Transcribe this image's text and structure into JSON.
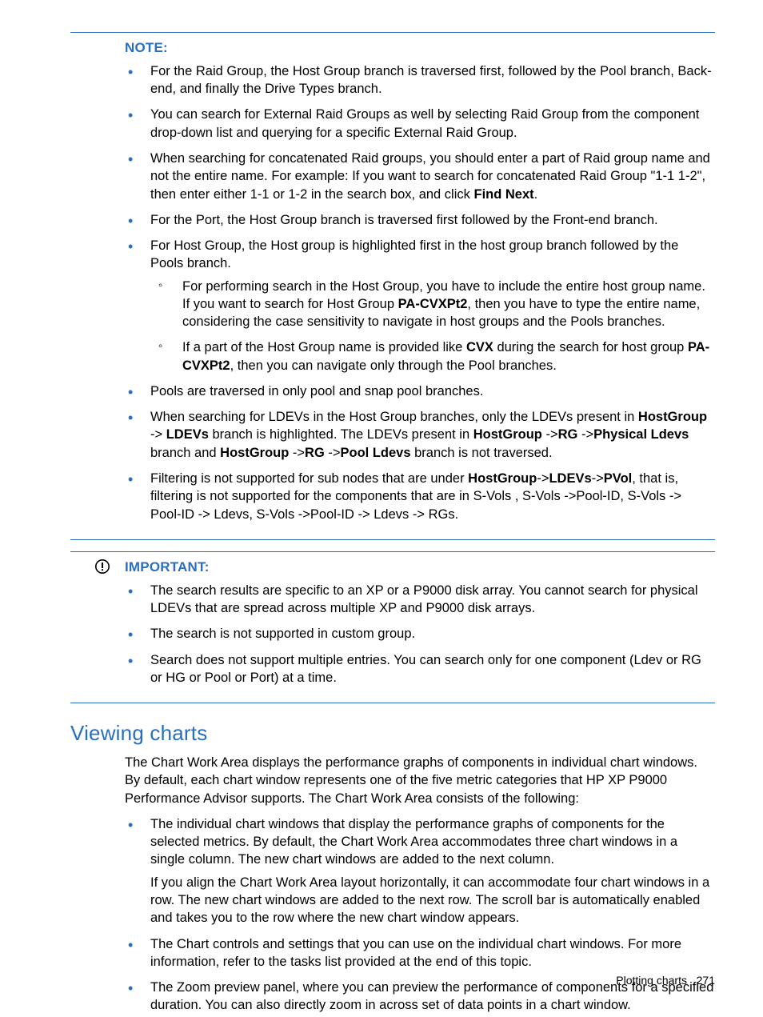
{
  "note": {
    "label": "NOTE:",
    "items": [
      {
        "html": "For the Raid Group, the Host Group branch is traversed first, followed by the Pool branch, Back-end, and finally the Drive Types branch."
      },
      {
        "html": "You can search for External Raid Groups as well by selecting Raid Group from the component drop-down list and querying for a specific External Raid Group."
      },
      {
        "html": "When searching for concatenated Raid groups, you should enter a part of Raid group name and not the entire name. For example: If you want to search for concatenated Raid Group \"1-1 1-2\", then enter either 1-1 or 1-2 in the search box, and click <b>Find Next</b>."
      },
      {
        "html": "For the Port, the Host Group branch is traversed first followed by the Front-end branch."
      },
      {
        "html": "For Host Group, the Host group is highlighted first in the host group branch followed by the Pools branch.",
        "sub": [
          {
            "html": "For performing search in the Host Group, you have to include the entire host group name. If you want to search for Host Group <b>PA-CVXPt2</b>, then you have to type the entire name, considering the case sensitivity to navigate in host groups and the Pools branches."
          },
          {
            "html": "If a part of the Host Group name is provided like <b>CVX</b> during the search for host group <b>PA-CVXPt2</b>, then you can navigate only through the Pool branches."
          }
        ]
      },
      {
        "html": "Pools are traversed in only pool and snap pool branches."
      },
      {
        "html": "When searching for LDEVs in the Host Group branches, only the LDEVs present in <b>HostGroup</b> -> <b>LDEVs</b> branch is highlighted. The LDEVs present in <b>HostGroup</b> -><b>RG</b> -><b>Physical Ldevs</b> branch and <b>HostGroup</b> -><b>RG</b> -><b>Pool Ldevs</b> branch is not traversed."
      },
      {
        "html": "Filtering is not supported for sub nodes that are under <b>HostGroup</b>-><b>LDEVs</b>-><b>PVol</b>, that is, filtering is not supported for the components that are in S-Vols , S-Vols ->Pool-ID, S-Vols -> Pool-ID -> Ldevs, S-Vols ->Pool-ID -> Ldevs -> RGs."
      }
    ]
  },
  "important": {
    "label": "IMPORTANT:",
    "items": [
      {
        "html": "The search results are specific to an XP or a P9000 disk array. You cannot search for physical LDEVs that are spread across multiple XP and P9000 disk arrays."
      },
      {
        "html": "The search is not supported in custom group."
      },
      {
        "html": "Search does not support multiple entries. You can search only for one component (Ldev or RG or HG or Pool or Port) at a time."
      }
    ]
  },
  "section": {
    "heading": "Viewing charts",
    "intro": "The Chart Work Area displays the performance graphs of components in individual chart windows. By default, each chart window represents one of the five metric categories that HP XP P9000 Performance Advisor supports. The Chart Work Area consists of the following:",
    "items": [
      {
        "html": "The individual chart windows that display the performance graphs of components for the selected metrics. By default, the Chart Work Area accommodates three chart windows in a single column. The new chart windows are added to the next column.",
        "extra": "If you align the Chart Work Area layout horizontally, it can accommodate four chart windows in a row. The new chart windows are added to the next row. The scroll bar is automatically enabled and takes you to the row where the new chart window appears."
      },
      {
        "html": "The Chart controls and settings that you can use on the individual chart windows. For more information, refer to the tasks list provided at the end of this topic."
      },
      {
        "html": "The Zoom preview panel, where you can preview the performance of components for a specified duration. You can also directly zoom in across set of data points in a chart window."
      }
    ]
  },
  "footer": {
    "text": "Plotting charts",
    "page": "271"
  }
}
